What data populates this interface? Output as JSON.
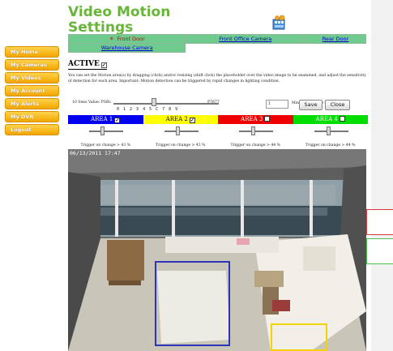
{
  "page": {
    "title_line1": "Video Motion",
    "title_line2": "Settings"
  },
  "icons": {
    "camera": "camera-film-icon"
  },
  "sidebar": {
    "items": [
      {
        "label": "My Home"
      },
      {
        "label": "My Cameras"
      },
      {
        "label": "My Videos"
      },
      {
        "label": "My Account"
      },
      {
        "label": "My Alerts"
      },
      {
        "label": "My DVR"
      },
      {
        "label": "Logout"
      }
    ]
  },
  "cameras": {
    "tabs": [
      {
        "label": "Front Door",
        "current": true
      },
      {
        "label": "Front Office Camera",
        "current": false
      },
      {
        "label": "Rear Door",
        "current": false
      },
      {
        "label": "Warehouse Camera",
        "current": false
      }
    ]
  },
  "motion": {
    "active_label": "ACTIVE",
    "active_checked": true,
    "instructions": "You can set the Motion area(s) by dragging (click) and/or resizing (shift click) the placeholder over the video image to be examined, and adjust the sensitivity of detection for each area. Important: Motion detection can be triggered by rapid changes in lighting condition.",
    "sensitivity_label": "10 Sens Value: PSBs",
    "sensitivity_right": "P7677",
    "sensitivity_ticks": "0 1 2 3 4 5 C 7 8 9",
    "wait_value": "1",
    "wait_label": "Min. Wait before next trigger",
    "save_label": "Save",
    "close_label": "Close",
    "timestamp": "06/13/2011 17:47"
  },
  "areas": [
    {
      "label": "AREA 1",
      "color": "#0000ee",
      "checked": true,
      "trigger": "Trigger on change > 43 %"
    },
    {
      "label": "AREA 2",
      "color": "#ffff00",
      "checked": true,
      "trigger": "Trigger on change > 43 %"
    },
    {
      "label": "AREA 3",
      "color": "#ee0000",
      "checked": false,
      "trigger": "Trigger on change > 44 %"
    },
    {
      "label": "AREA 4",
      "color": "#00dd00",
      "checked": false,
      "trigger": "Trigger on change > 44 %"
    }
  ]
}
